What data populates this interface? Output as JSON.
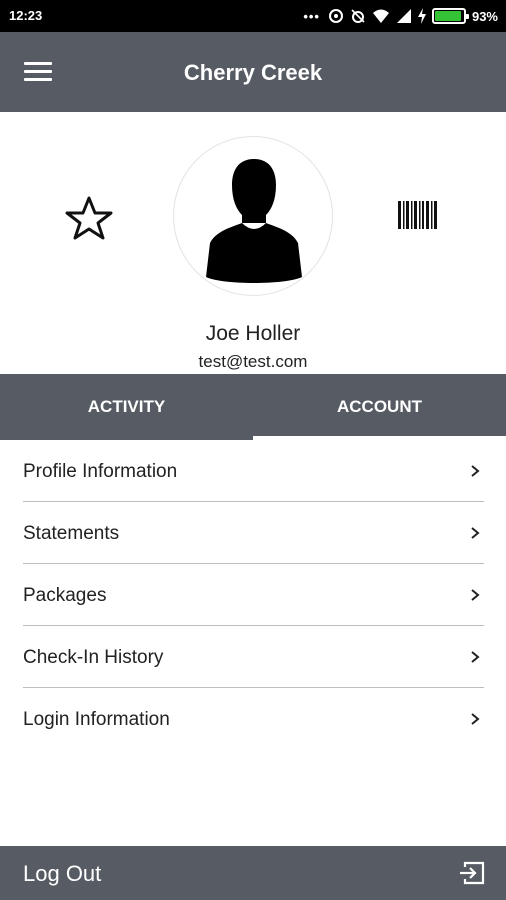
{
  "status_bar": {
    "time": "12:23",
    "battery": "93%",
    "battery_level": 0.93,
    "icons": [
      "more-dots-icon",
      "sync-icon",
      "alarm-icon",
      "wifi-icon",
      "signal-icon",
      "charging-icon",
      "battery-icon"
    ]
  },
  "header": {
    "title": "Cherry Creek",
    "menu_icon": "hamburger-menu-icon"
  },
  "profile": {
    "name": "Joe Holler",
    "email": "test@test.com",
    "favorite_icon": "star-icon",
    "barcode_icon": "barcode-icon",
    "avatar_icon": "person-silhouette-icon"
  },
  "tabs": [
    {
      "label": "ACTIVITY",
      "active": false
    },
    {
      "label": "ACCOUNT",
      "active": true
    }
  ],
  "menu": {
    "items": [
      {
        "label": "Profile Information"
      },
      {
        "label": "Statements"
      },
      {
        "label": "Packages"
      },
      {
        "label": "Check-In History"
      },
      {
        "label": "Login Information"
      }
    ]
  },
  "footer": {
    "logout_label": "Log Out",
    "logout_icon": "logout-icon"
  },
  "colors": {
    "bar": "#575c64",
    "divider": "#bdbdbd",
    "battery_fill": "#35c234"
  }
}
